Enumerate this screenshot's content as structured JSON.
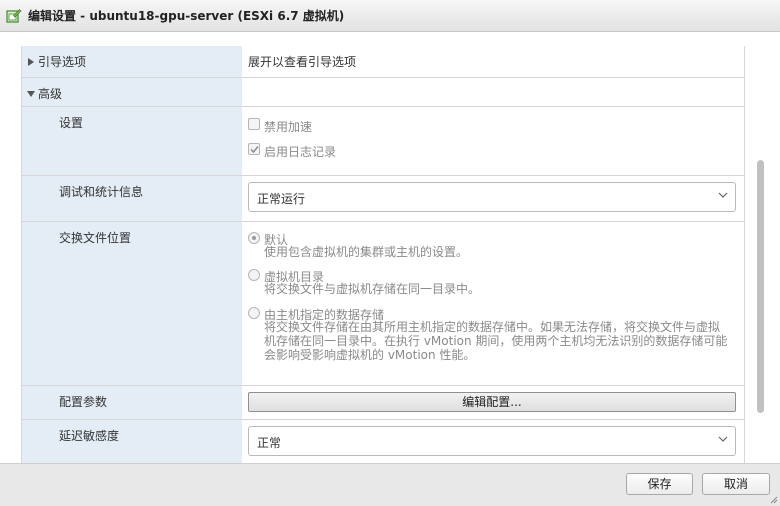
{
  "window": {
    "title": "编辑设置 - ubuntu18-gpu-server (ESXi 6.7 虚拟机)"
  },
  "boot_options": {
    "label": "引导选项",
    "value": "展开以查看引导选项"
  },
  "advanced": {
    "label": "高级",
    "settings": {
      "label": "设置",
      "disable_acceleration": {
        "label": "禁用加速",
        "checked": false
      },
      "enable_logging": {
        "label": "启用日志记录",
        "checked": true
      }
    },
    "debug": {
      "label": "调试和统计信息",
      "selected": "正常运行"
    },
    "swap": {
      "label": "交换文件位置",
      "options": [
        {
          "label": "默认",
          "desc": "使用包含虚拟机的集群或主机的设置。",
          "selected": true
        },
        {
          "label": "虚拟机目录",
          "desc": "将交换文件与虚拟机存储在同一目录中。",
          "selected": false
        },
        {
          "label": "由主机指定的数据存储",
          "desc_lines": [
            "将交换文件存储在由其所用主机指定的数据存储中。如果无法存储，将交换文件与虚拟",
            "机存储在同一目录中。在执行 vMotion 期间，使用两个主机均无法识别的数据存储可能",
            "会影响受影响虚拟机的 vMotion 性能。"
          ],
          "selected": false
        }
      ]
    },
    "config_params": {
      "label": "配置参数",
      "button": "编辑配置..."
    },
    "latency": {
      "label": "延迟敏感度",
      "selected": "正常"
    }
  },
  "footer": {
    "save": "保存",
    "cancel": "取消"
  },
  "colors": {
    "label_bg": "#e4edf5",
    "border": "#d6d6d6"
  }
}
